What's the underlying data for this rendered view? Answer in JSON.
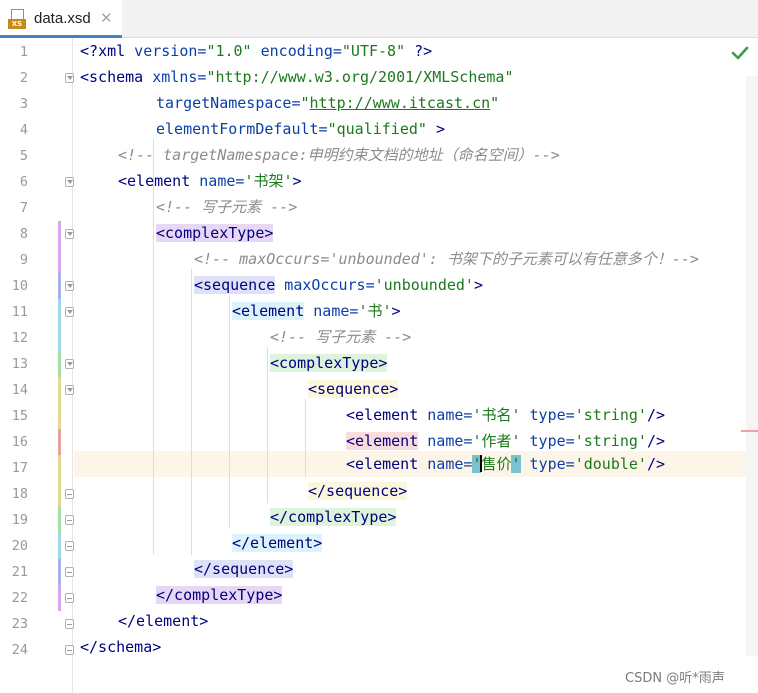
{
  "tab": {
    "label": "data.xsd",
    "icon_badge": "XS",
    "close_glyph": "✕"
  },
  "line_numbers": [
    "1",
    "2",
    "3",
    "4",
    "5",
    "6",
    "7",
    "8",
    "9",
    "10",
    "11",
    "12",
    "13",
    "14",
    "15",
    "16",
    "17",
    "18",
    "19",
    "20",
    "21",
    "22",
    "23",
    "24"
  ],
  "code": {
    "l1": {
      "a": "<?",
      "b": "xml",
      "c": " version=",
      "d": "\"1.0\"",
      "e": " encoding=",
      "f": "\"UTF-8\"",
      "g": " ?>"
    },
    "l2": {
      "a": "<schema",
      "b": " xmlns=",
      "c": "\"http://www.w3.org/2001/XMLSchema\""
    },
    "l3": {
      "a": "targetNamespace=",
      "b": "\"",
      "c": "http://www.itcast.cn",
      "d": "\""
    },
    "l4": {
      "a": "elementFormDefault=",
      "b": "\"qualified\"",
      "c": " >"
    },
    "l5": {
      "a": "<!-- targetNamespace:申明约束文档的地址（命名空间）-->"
    },
    "l6": {
      "a": "<element",
      "b": " name=",
      "c": "'书架'",
      "d": ">"
    },
    "l7": {
      "a": "<!-- 写子元素 -->"
    },
    "l8": {
      "a": "<complexType>"
    },
    "l9": {
      "a": "<!-- maxOccurs='unbounded': 书架下的子元素可以有任意多个！-->"
    },
    "l10": {
      "a": "<sequence",
      "b": " maxOccurs=",
      "c": "'unbounded'",
      "d": ">"
    },
    "l11": {
      "a": "<element",
      "b": " name=",
      "c": "'书'",
      "d": ">"
    },
    "l12": {
      "a": "<!-- 写子元素 -->"
    },
    "l13": {
      "a": "<complexType>"
    },
    "l14": {
      "a": "<sequence>"
    },
    "l15": {
      "a": "<element",
      "b": " name=",
      "c": "'书名'",
      "d": " type=",
      "e": "'string'",
      "f": "/>"
    },
    "l16": {
      "a": "<element",
      "b": " name=",
      "c": "'作者'",
      "d": " type=",
      "e": "'string'",
      "f": "/>"
    },
    "l17": {
      "a": "<element",
      "b": " name=",
      "c1": "'",
      "c2": "售价",
      "c3": "'",
      "d": " type=",
      "e": "'double'",
      "f": "/>"
    },
    "l18": {
      "a": "</sequence>"
    },
    "l19": {
      "a": "</complexType>"
    },
    "l20": {
      "a": "</element>"
    },
    "l21": {
      "a": "</sequence>"
    },
    "l22": {
      "a": "</complexType>"
    },
    "l23": {
      "a": "</element>"
    },
    "l24": {
      "a": "</schema>"
    }
  },
  "watermark": "CSDN @听*雨声",
  "colors": {
    "tag_purple": "#e8d6f5",
    "tag_blue": "#dfe2f7",
    "tag_cyan": "#dbf3fb",
    "tag_green": "#dcf3dc",
    "tag_yellow": "#fbf7dc",
    "tag_red": "#fadcdc",
    "accent_tab": "#4083c9",
    "ok_green": "#3c9a4a"
  },
  "status": {
    "inspection_icon": "check-icon"
  }
}
